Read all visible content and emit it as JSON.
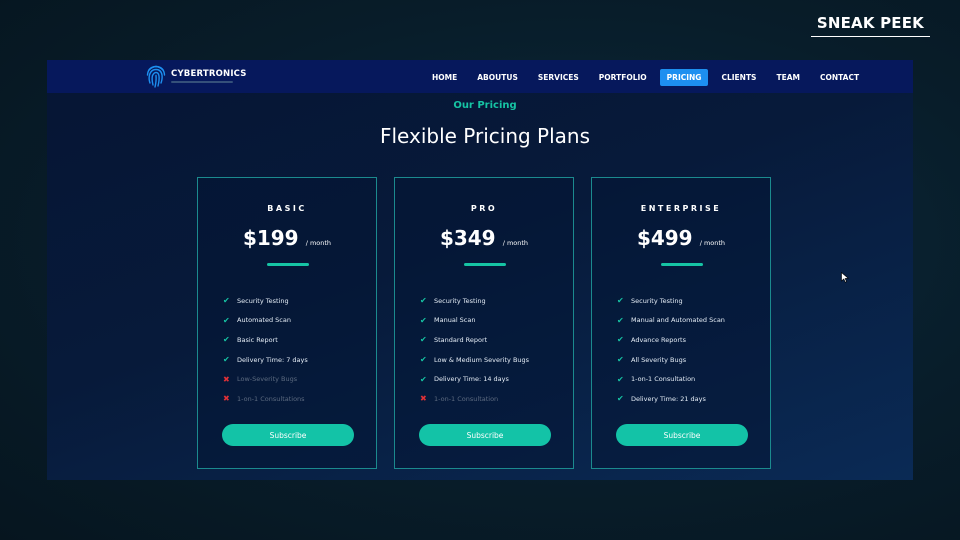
{
  "overlay": {
    "label": "SNEAK PEEK"
  },
  "brand": {
    "name": "CYBERTRONICS"
  },
  "nav": {
    "items": [
      {
        "label": "HOME",
        "active": false
      },
      {
        "label": "ABOUTUS",
        "active": false
      },
      {
        "label": "SERVICES",
        "active": false
      },
      {
        "label": "PORTFOLIO",
        "active": false
      },
      {
        "label": "PRICING",
        "active": true
      },
      {
        "label": "CLIENTS",
        "active": false
      },
      {
        "label": "TEAM",
        "active": false
      },
      {
        "label": "CONTACT",
        "active": false
      }
    ]
  },
  "section": {
    "eyebrow": "Our Pricing",
    "title": "Flexible Pricing Plans"
  },
  "plans": [
    {
      "name": "BASIC",
      "price": "$199",
      "period": "/ month",
      "features": [
        {
          "text": "Security Testing",
          "included": true
        },
        {
          "text": "Automated Scan",
          "included": true
        },
        {
          "text": "Basic Report",
          "included": true
        },
        {
          "text": "Delivery Time: 7 days",
          "included": true
        },
        {
          "text": "Low-Severity Bugs",
          "included": false
        },
        {
          "text": "1-on-1 Consultations",
          "included": false
        }
      ],
      "button": "Subscribe"
    },
    {
      "name": "PRO",
      "price": "$349",
      "period": "/ month",
      "features": [
        {
          "text": "Security Testing",
          "included": true
        },
        {
          "text": "Manual Scan",
          "included": true
        },
        {
          "text": "Standard Report",
          "included": true
        },
        {
          "text": "Low & Medium Severity Bugs",
          "included": true
        },
        {
          "text": "Delivery Time: 14 days",
          "included": true
        },
        {
          "text": "1-on-1 Consultation",
          "included": false
        }
      ],
      "button": "Subscribe"
    },
    {
      "name": "ENTERPRISE",
      "price": "$499",
      "period": "/ month",
      "features": [
        {
          "text": "Security Testing",
          "included": true
        },
        {
          "text": "Manual and Automated Scan",
          "included": true
        },
        {
          "text": "Advance Reports",
          "included": true
        },
        {
          "text": "All Severity Bugs",
          "included": true
        },
        {
          "text": "1-on-1 Consultation",
          "included": true
        },
        {
          "text": "Delivery Time: 21 days",
          "included": true
        }
      ],
      "button": "Subscribe"
    }
  ],
  "colors": {
    "accent": "#16c4a4",
    "nav_active": "#1d8ff0",
    "navbar": "#06185c",
    "cross": "#e03137"
  },
  "icons": {
    "logo": "fingerprint-icon",
    "included": "check-icon",
    "excluded": "cross-icon",
    "pointer": "mouse-cursor-icon"
  }
}
